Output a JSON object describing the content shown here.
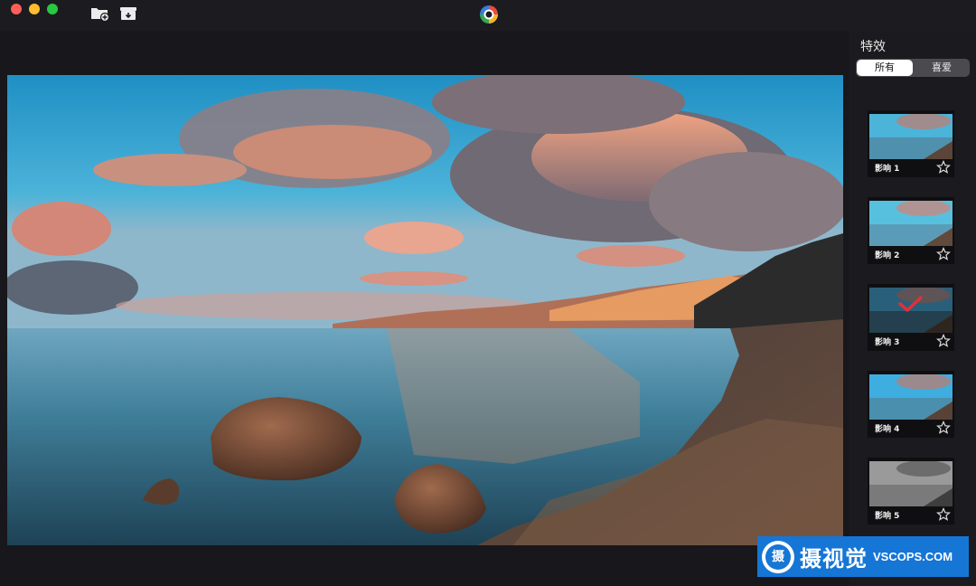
{
  "titlebar": {
    "icons": [
      "close-window-icon",
      "minimize-window-icon",
      "zoom-window-icon",
      "add-folder-icon",
      "archive-box-icon",
      "app-logo-icon"
    ]
  },
  "canvas": {
    "image_description_icon": "lake-sunset-photo"
  },
  "panel": {
    "title": "特效",
    "tabs": [
      {
        "label": "所有",
        "active": true
      },
      {
        "label": "喜爱",
        "active": false
      }
    ],
    "effects": [
      {
        "label": "影响 1",
        "selected": false,
        "style": "color"
      },
      {
        "label": "影响 2",
        "selected": false,
        "style": "color"
      },
      {
        "label": "影响 3",
        "selected": true,
        "style": "dark"
      },
      {
        "label": "影响 4",
        "selected": false,
        "style": "color"
      },
      {
        "label": "影响 5",
        "selected": false,
        "style": "mono"
      }
    ]
  },
  "watermark": {
    "badge": "摄",
    "text": "摄视觉",
    "domain": "VSCOPS.COM"
  },
  "colors": {
    "accent": "#1576d6",
    "selected_check": "#e0303a",
    "panel_bg": "#1a1a1f"
  }
}
